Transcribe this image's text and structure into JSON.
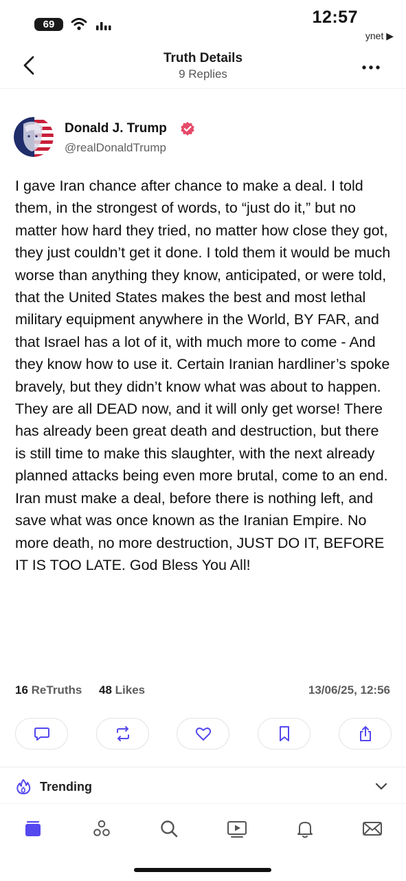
{
  "status_bar": {
    "battery": "69",
    "time": "12:57",
    "back_app": "ynet ▶"
  },
  "header": {
    "title": "Truth Details",
    "subtitle": "9 Replies"
  },
  "post": {
    "author_name": "Donald J. Trump",
    "author_handle": "@realDonaldTrump",
    "text": "I gave Iran chance after chance to make a deal. I told them, in the strongest of words, to “just do it,” but no matter how hard they tried, no matter how close they got, they just couldn’t get it done. I told them it would be much worse than anything they know, anticipated, or were told, that the United States makes the best and most lethal military equipment anywhere in the World, BY FAR, and that Israel has a lot of it, with much more to come - And they know how to use it. Certain Iranian hardliner’s spoke bravely, but they didn’t know what was about to happen. They are all DEAD now, and it will only get worse! There has already been great death and destruction, but there is still time to make this slaughter, with the next already planned attacks being even more brutal, come to an end. Iran must make a deal, before there is nothing left, and save what was once known as the Iranian Empire. No more death, no more destruction, JUST DO IT, BEFORE IT IS TOO LATE. God Bless You All!",
    "retruths_count": "16",
    "retruths_label": "ReTruths",
    "likes_count": "48",
    "likes_label": "Likes",
    "timestamp": "13/06/25, 12:56"
  },
  "actions": [
    {
      "icon": "comment-icon"
    },
    {
      "icon": "retruth-icon"
    },
    {
      "icon": "heart-icon"
    },
    {
      "icon": "bookmark-icon"
    },
    {
      "icon": "share-icon"
    }
  ],
  "trending": {
    "label": "Trending"
  },
  "bottom_nav": [
    {
      "icon": "home-icon",
      "active": true
    },
    {
      "icon": "groups-icon"
    },
    {
      "icon": "search-icon"
    },
    {
      "icon": "video-icon"
    },
    {
      "icon": "notifications-icon"
    },
    {
      "icon": "messages-icon"
    }
  ],
  "colors": {
    "accent": "#5448ee",
    "verified": "#e64a6a",
    "text": "#111111",
    "muted": "#5d5d5d"
  }
}
